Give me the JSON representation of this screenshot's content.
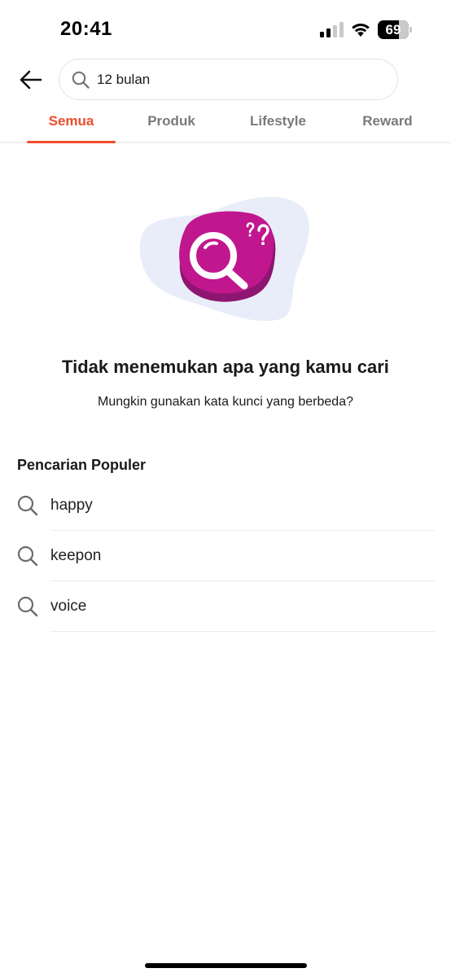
{
  "status_bar": {
    "time": "20:41",
    "battery_level": "69",
    "battery_fraction": 0.69,
    "icons": [
      "signal-icon",
      "wifi-icon",
      "battery-icon"
    ]
  },
  "header": {
    "back_icon": "arrow-left-icon",
    "search": {
      "value": "12 bulan",
      "icon": "search-icon"
    }
  },
  "tabs": [
    {
      "label": "Semua",
      "active": true
    },
    {
      "label": "Produk",
      "active": false
    },
    {
      "label": "Lifestyle",
      "active": false
    },
    {
      "label": "Reward",
      "active": false
    }
  ],
  "empty_state": {
    "illustration": "magnifier-question-illustration",
    "title": "Tidak menemukan apa yang kamu cari",
    "subtitle": "Mungkin gunakan kata kunci yang berbeda?"
  },
  "popular": {
    "title": "Pencarian Populer",
    "items": [
      {
        "label": "happy",
        "icon": "search-icon"
      },
      {
        "label": "keepon",
        "icon": "search-icon"
      },
      {
        "label": "voice",
        "icon": "search-icon"
      }
    ]
  },
  "colors": {
    "accent": "#ee4d2d",
    "illustration_magenta": "#c0178f",
    "illustration_blob": "#e9edf9"
  }
}
